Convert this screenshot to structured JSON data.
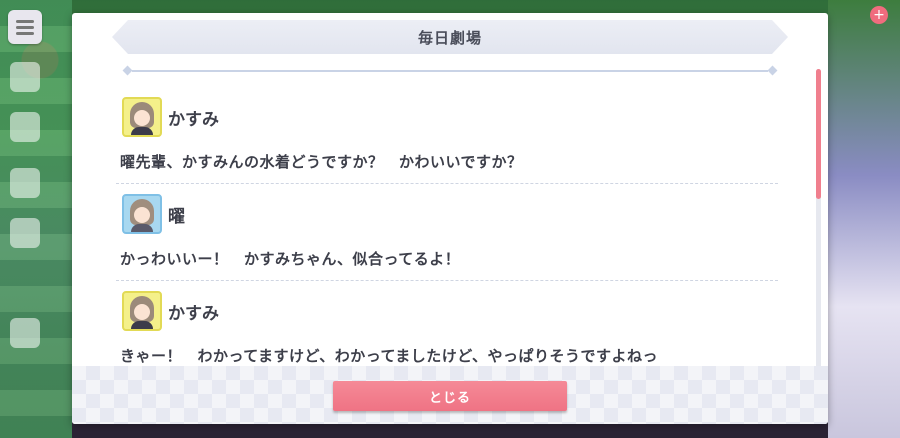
{
  "dialog": {
    "title": "毎日劇場",
    "close_label": "とじる"
  },
  "entries": [
    {
      "speaker": "かすみ",
      "avatar": "kasumi-avatar",
      "text": "曜先輩、かすみんの水着どうですか？　かわいいですか？"
    },
    {
      "speaker": "曜",
      "avatar": "you-avatar",
      "text": "かっわいいー！　かすみちゃん、似合ってるよ！"
    },
    {
      "speaker": "かすみ",
      "avatar": "kasumi-avatar",
      "text": "きゃー！　わかってますけど、わかってましたけど、やっぱりそうですよねっ"
    }
  ],
  "colors": {
    "accent": "#ef7384",
    "title_bar": "#e4e7f0",
    "text": "#3d3f4a",
    "kasumi_avatar_bg": "#f4f08a",
    "you_avatar_bg": "#a8d8f0"
  },
  "icons": [
    "hamburger-menu-icon",
    "plus-icon"
  ]
}
